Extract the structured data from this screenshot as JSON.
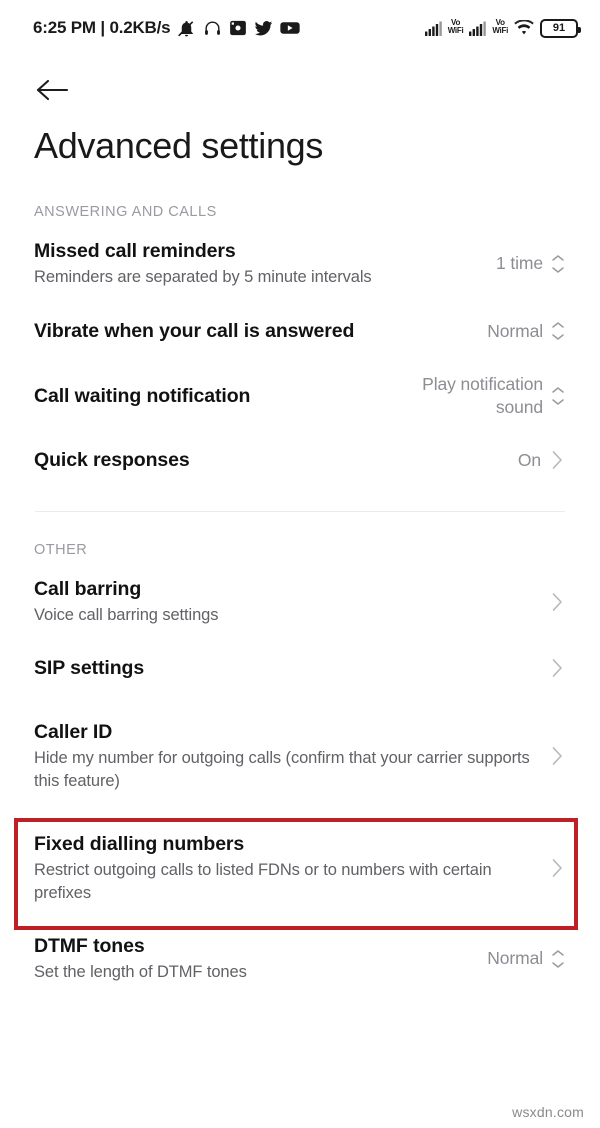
{
  "statusbar": {
    "clock": "6:25 PM | 0.2KB/s",
    "left_icons": [
      "bell-muted-icon",
      "headphones-icon",
      "screenshot-icon",
      "twitter-icon",
      "youtube-icon"
    ],
    "signal_1_label": "Vo",
    "signal_1_label2": "WiFi",
    "signal_2_label": "Vo",
    "signal_2_label2": "WiFi",
    "battery_level": "91"
  },
  "header": {
    "back_icon": "arrow-left-icon",
    "title": "Advanced settings"
  },
  "sections": [
    {
      "header": "ANSWERING AND CALLS",
      "rows": [
        {
          "title": "Missed call reminders",
          "subtitle": "Reminders are separated by 5 minute intervals",
          "value": "1 time",
          "control": "stepper"
        },
        {
          "title": "Vibrate when your call is answered",
          "subtitle": "",
          "value": "Normal",
          "control": "stepper"
        },
        {
          "title": "Call waiting notification",
          "subtitle": "",
          "value": "Play notification sound",
          "control": "stepper"
        },
        {
          "title": "Quick responses",
          "subtitle": "",
          "value": "On",
          "control": "chevron"
        }
      ]
    },
    {
      "header": "OTHER",
      "rows": [
        {
          "title": "Call barring",
          "subtitle": "Voice call barring settings",
          "value": "",
          "control": "chevron"
        },
        {
          "title": "SIP settings",
          "subtitle": "",
          "value": "",
          "control": "chevron"
        },
        {
          "title": "Caller ID",
          "subtitle": "Hide my number for outgoing calls (confirm that your carrier supports this feature)",
          "value": "",
          "control": "chevron",
          "highlighted": true
        },
        {
          "title": "Fixed dialling numbers",
          "subtitle": "Restrict outgoing calls to listed FDNs or to numbers with certain prefixes",
          "value": "",
          "control": "chevron"
        },
        {
          "title": "DTMF tones",
          "subtitle": "Set the length of DTMF tones",
          "value": "Normal",
          "control": "stepper"
        }
      ]
    }
  ],
  "annotation": {
    "color": "#be2026",
    "target": "Caller ID"
  },
  "watermark": "wsxdn.com"
}
